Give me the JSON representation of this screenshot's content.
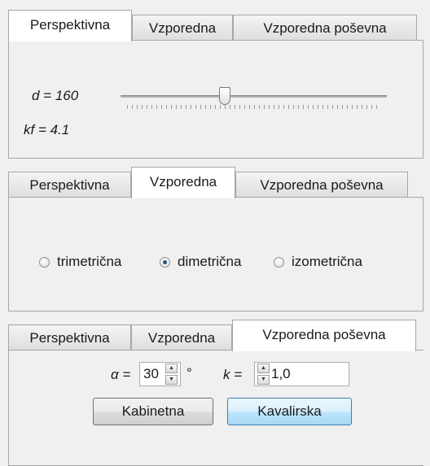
{
  "tabs": [
    "Perspektivna",
    "Vzporedna",
    "Vzporedna poševna"
  ],
  "panel1": {
    "active_tab": 0,
    "d_label": "d = 160",
    "kf_label": "kf = 4.1",
    "slider_fraction": 0.39
  },
  "panel2": {
    "active_tab": 1,
    "radios": [
      {
        "label": "trimetrična",
        "checked": false
      },
      {
        "label": "dimetrična",
        "checked": true
      },
      {
        "label": "izometrična",
        "checked": false
      }
    ]
  },
  "panel3": {
    "active_tab": 2,
    "alpha_label": "α =",
    "alpha_value": "30",
    "degree_symbol": "°",
    "k_label": "k =",
    "k_value": "1,0",
    "buttons": [
      "Kabinetna",
      "Kavalirska"
    ]
  },
  "icons": {
    "spin_up": "up-arrow-icon",
    "spin_down": "down-arrow-icon"
  }
}
